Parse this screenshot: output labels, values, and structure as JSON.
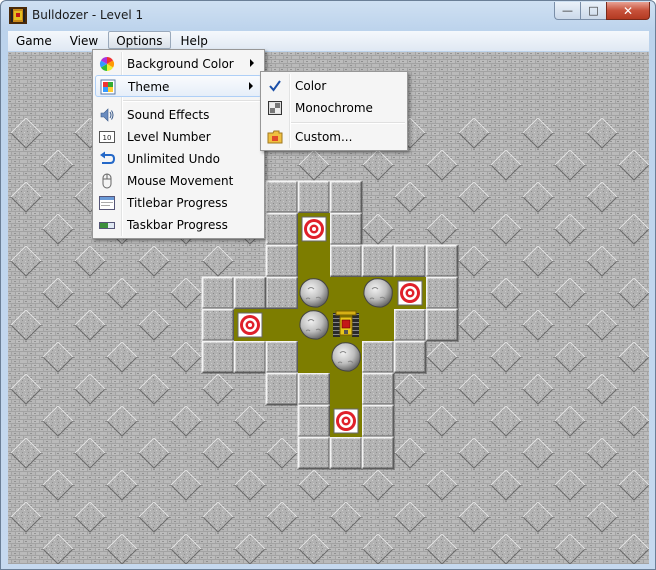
{
  "window": {
    "title": "Bulldozer - Level 1",
    "minimize_glyph": "—",
    "maximize_glyph": "□",
    "close_glyph": "✕"
  },
  "menubar": {
    "items": [
      {
        "label": "Game"
      },
      {
        "label": "View"
      },
      {
        "label": "Options"
      },
      {
        "label": "Help"
      }
    ],
    "active": "Options"
  },
  "options_menu": {
    "items": [
      {
        "label": "Background Color",
        "icon": "color-wheel-icon",
        "submenu": true
      },
      {
        "label": "Theme",
        "icon": "theme-icon",
        "submenu": true,
        "highlighted": true
      },
      {
        "label": "Sound Effects",
        "icon": "speaker-icon"
      },
      {
        "label": "Level Number",
        "icon": "level-number-icon"
      },
      {
        "label": "Unlimited Undo",
        "icon": "undo-icon"
      },
      {
        "label": "Mouse Movement",
        "icon": "mouse-icon"
      },
      {
        "label": "Titlebar Progress",
        "icon": "titlebar-icon"
      },
      {
        "label": "Taskbar Progress",
        "icon": "taskbar-icon"
      }
    ]
  },
  "theme_menu": {
    "items": [
      {
        "label": "Color",
        "icon": "checkmark-icon",
        "checked": true
      },
      {
        "label": "Monochrome",
        "icon": "monochrome-icon"
      },
      {
        "label": "Custom...",
        "icon": "folder-icon"
      }
    ]
  },
  "colors": {
    "floor": "#7d7d00",
    "wall_base": "#a6a6a6",
    "target_red": "#e0202a",
    "menu_highlight": "#aecff7",
    "checkmark": "#1b4fa8"
  },
  "level": {
    "grid_origin": "cells of 32px",
    "floor_cells": [
      [
        9,
        5
      ],
      [
        9,
        6
      ],
      [
        9,
        7
      ],
      [
        10,
        7
      ],
      [
        11,
        7
      ],
      [
        12,
        7
      ],
      [
        7,
        8
      ],
      [
        8,
        8
      ],
      [
        9,
        8
      ],
      [
        10,
        8
      ],
      [
        11,
        8
      ],
      [
        9,
        9
      ],
      [
        10,
        9
      ],
      [
        10,
        10
      ],
      [
        10,
        11
      ]
    ],
    "targets": [
      [
        9,
        5
      ],
      [
        12,
        7
      ],
      [
        7,
        8
      ],
      [
        10,
        11
      ]
    ],
    "rocks": [
      [
        9,
        7
      ],
      [
        11,
        7
      ],
      [
        9,
        8
      ],
      [
        10,
        9
      ]
    ],
    "bulldozer": [
      10,
      8
    ]
  }
}
